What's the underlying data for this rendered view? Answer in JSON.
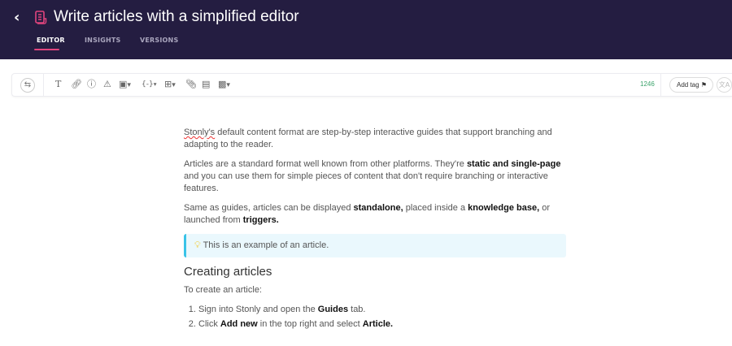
{
  "header": {
    "back_icon": "chevron-left",
    "doc_icon": "article-icon",
    "title": "Write articles with a simplified editor",
    "tabs": [
      {
        "label": "EDITOR",
        "active": true
      },
      {
        "label": "INSIGHTS"
      },
      {
        "label": "VERSIONS"
      }
    ],
    "accent": "#e2457e",
    "background": "#241d41"
  },
  "toolbar": {
    "word_count": "1246",
    "add_tag": "Add tag",
    "icons": [
      "switch-icon",
      "text-icon",
      "link-icon",
      "info-icon",
      "warning-icon",
      "image-icon",
      "variable-icon",
      "table-icon",
      "attachment-icon",
      "comment-icon",
      "embed-icon",
      "tag-icon",
      "translate-icon"
    ]
  },
  "content": {
    "p1": {
      "s0": "Stonly's",
      "s1": " default content format are step-by-step interactive guides that support branching and adapting to the reader."
    },
    "p2": {
      "s0": "Articles are a standard format well known from other platforms. They're ",
      "s1": "static and single-page",
      "s2": " and you can use them for simple pieces of content that don't require branching or interactive features."
    },
    "p3": {
      "s0": "Same as guides, articles can be displayed ",
      "s1": "standalone,",
      "s2": " placed inside a ",
      "s3": "knowledge base,",
      "s4": " or launched from ",
      "s5": "triggers."
    },
    "callout": {
      "icon": "lightbulb-icon",
      "text": "This is an example of an article."
    },
    "heading": "Creating articles",
    "p4": "To create an article:",
    "steps": [
      {
        "s0": "Sign into Stonly and open the ",
        "s1": "Guides",
        "s2": " tab."
      },
      {
        "s0": "Click ",
        "s1": "Add new",
        "s2": " in the top right and select ",
        "s3": "Article."
      }
    ]
  }
}
